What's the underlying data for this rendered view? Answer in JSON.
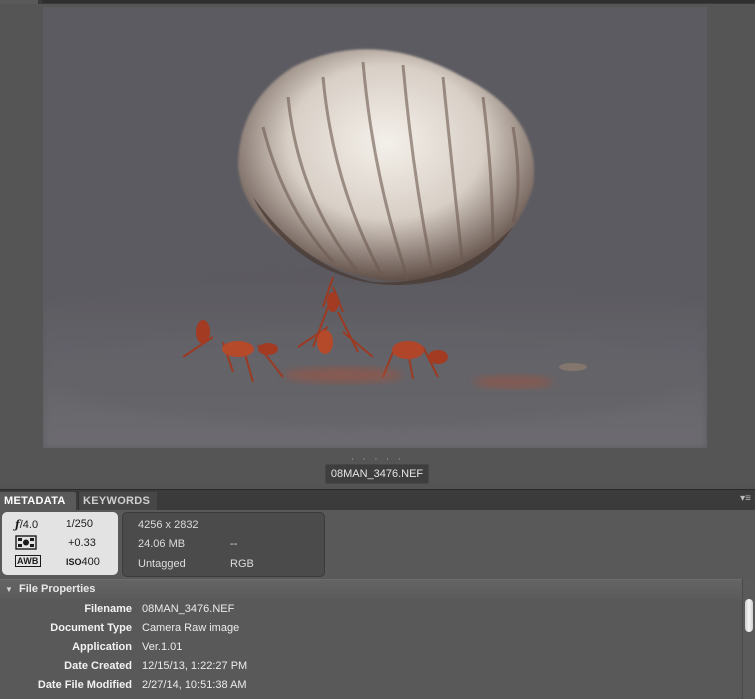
{
  "preview": {
    "filename": "08MAN_3476.NEF",
    "splitter_dots": "· · · · ·"
  },
  "tabs": [
    {
      "label": "METADATA",
      "active": true
    },
    {
      "label": "KEYWORDS",
      "active": false
    }
  ],
  "panel_menu_icon": "panel-menu-icon",
  "camera": {
    "aperture_symbol": "ƒ",
    "aperture_value": "/4.0",
    "shutter_num": "1",
    "shutter_den": "/250",
    "metering_icon": "metering-icon",
    "exposure_comp": "+0.33",
    "wb_label": "AWB",
    "iso_label": "ISO",
    "iso_value": "400"
  },
  "file_info": {
    "dimensions": "4256 x 2832",
    "size": "24.06 MB",
    "dpi": "--",
    "label": "Untagged",
    "color_mode": "RGB"
  },
  "section": {
    "title": "File Properties"
  },
  "properties": [
    {
      "label": "Filename",
      "value": "08MAN_3476.NEF"
    },
    {
      "label": "Document Type",
      "value": "Camera Raw image"
    },
    {
      "label": "Application",
      "value": "Ver.1.01"
    },
    {
      "label": "Date Created",
      "value": "12/15/13, 1:22:27 PM"
    },
    {
      "label": "Date File Modified",
      "value": "2/27/14, 10:51:38 AM"
    }
  ],
  "colors": {
    "panel_bg": "#535353",
    "tab_bar": "#3b3b3b",
    "camera_box": "#e3e3e3"
  }
}
